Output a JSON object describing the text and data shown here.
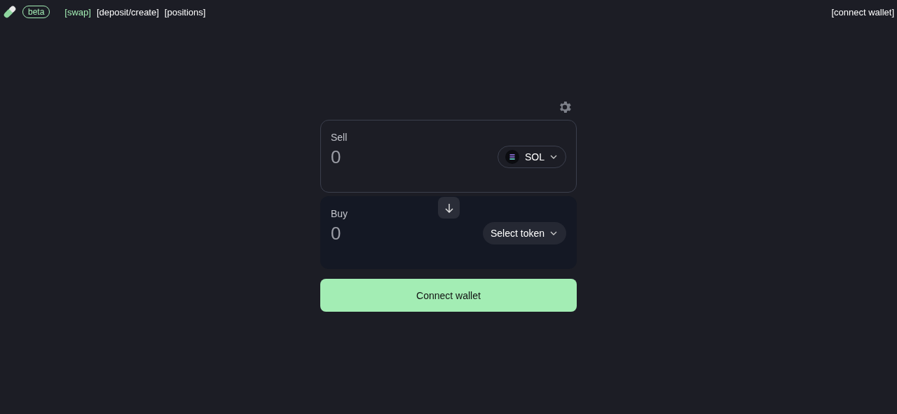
{
  "header": {
    "badge": "beta",
    "nav": [
      {
        "label": "[swap]",
        "selected": true
      },
      {
        "label": "[deposit/create]",
        "selected": false
      },
      {
        "label": "[positions]",
        "selected": false
      }
    ],
    "wallet_link": "[connect wallet]"
  },
  "swap": {
    "panels": [
      {
        "label": "Sell",
        "placeholder": "0",
        "token": "SOL",
        "has_token": true,
        "focused": true
      },
      {
        "label": "Buy",
        "placeholder": "0",
        "token": "Select token",
        "has_token": false,
        "focused": false
      }
    ],
    "submit": "Connect wallet"
  }
}
